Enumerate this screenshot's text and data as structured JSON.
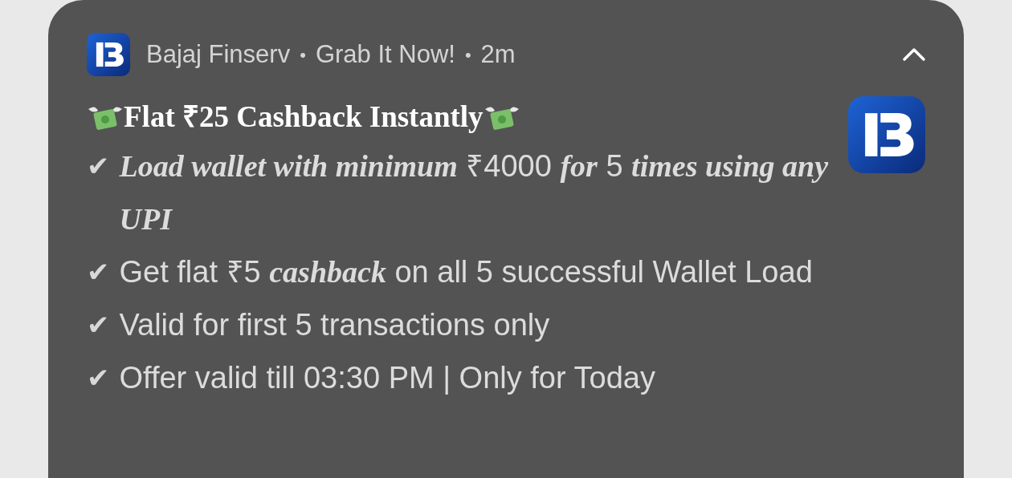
{
  "notification": {
    "expanded": true,
    "header": [
      {
        "text": "Bajaj Finserv"
      },
      {
        "separator": "•",
        "text": "Grab It Now!"
      },
      {
        "separator": "•",
        "text": "2m"
      }
    ],
    "title": "Flat ₹25 Cashback Instantly",
    "lines": [
      {
        "bullet": "✔",
        "text": "*Load wallet with minimum* ₹4000 *for* 5 *times using any UPI*"
      },
      {
        "bullet": "✔",
        "text": "Get flat ₹5 *cashback* on all 5 successful Wallet Load"
      },
      {
        "bullet": "✔",
        "text": "Valid for first 5 transactions only"
      },
      {
        "bullet": "✔",
        "text": "Offer valid till 03:30 PM | Only for Today"
      }
    ]
  }
}
